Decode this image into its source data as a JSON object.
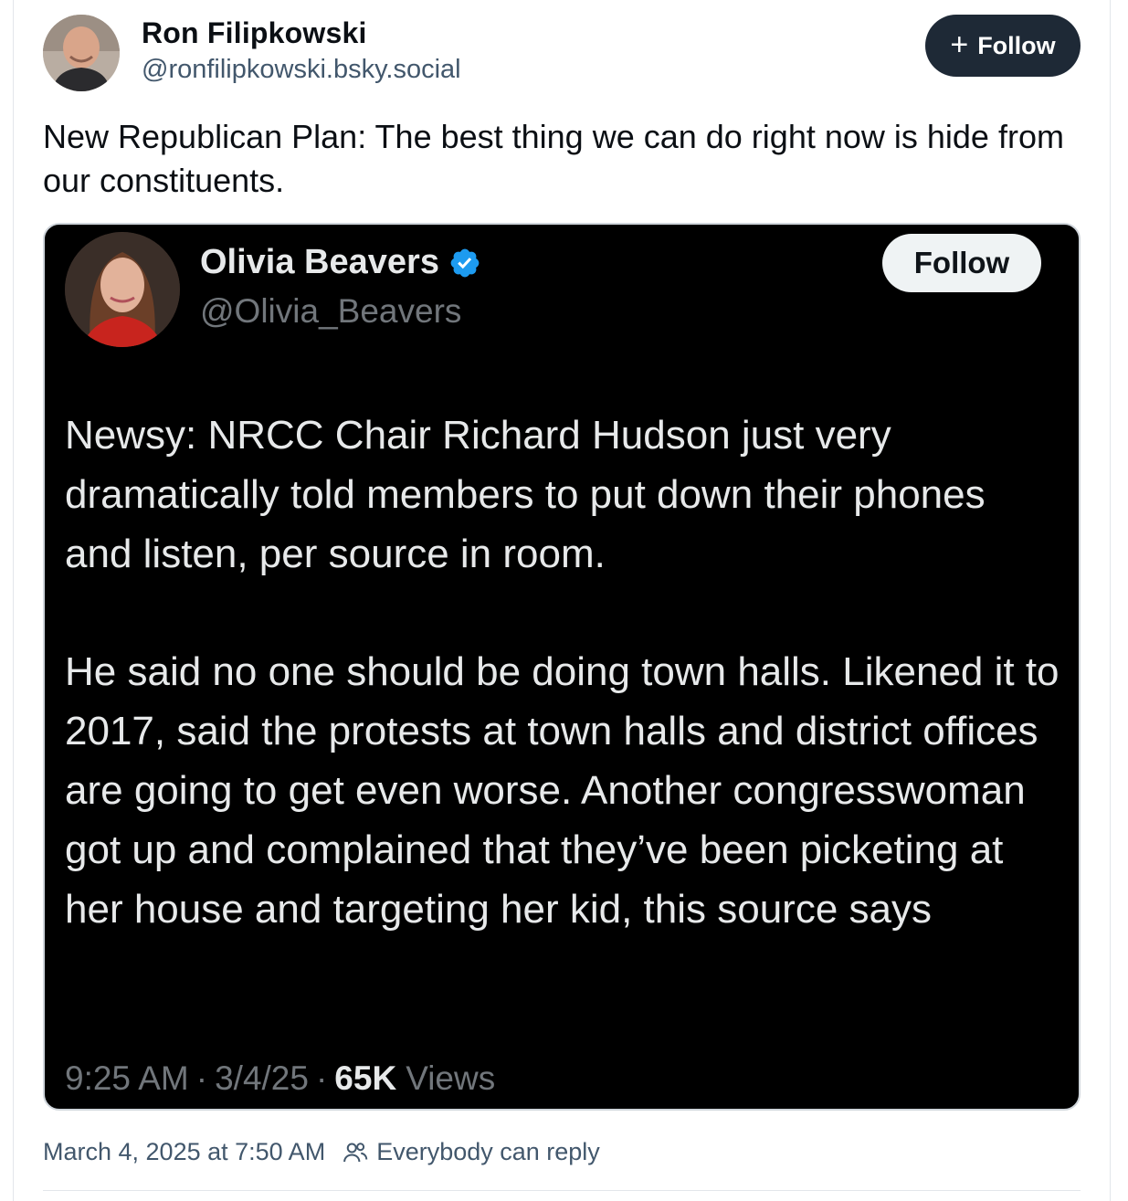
{
  "post": {
    "author": {
      "name": "Ron Filipkowski",
      "handle": "@ronfilipkowski.bsky.social",
      "avatar_icon": "user-avatar-photo"
    },
    "follow_button": {
      "icon": "plus-icon",
      "label": "Follow"
    },
    "text": "New Republican Plan: The best thing we can do right now is hide from our constituents.",
    "embed": {
      "author": {
        "name": "Olivia Beavers",
        "handle": "@Olivia_Beavers",
        "verified_icon": "verified-badge-icon",
        "avatar_icon": "user-avatar-photo"
      },
      "follow_label": "Follow",
      "paragraphs": [
        "Newsy: NRCC Chair Richard Hudson just very dramatically told members to put down their phones and listen, per source in room.",
        "He said no one should be doing town halls. Likened it to 2017, said the protests at town halls and district offices are going to get even worse. Another congresswoman got up and complained that they’ve been picketing at her house and targeting her kid, this source says"
      ],
      "time": "9:25 AM",
      "date": "3/4/25",
      "views_count": "65K",
      "views_label": "Views",
      "separator": "·"
    },
    "timestamp": "March 4, 2025 at 7:50 AM",
    "reply_setting_icon": "people-icon",
    "reply_setting": "Everybody can reply"
  },
  "colors": {
    "follow_button_bg": "#1e2936",
    "handle_text": "#42576c",
    "embed_bg": "#000000",
    "verified_blue": "#1d9bf0",
    "embed_muted": "#71767b"
  }
}
